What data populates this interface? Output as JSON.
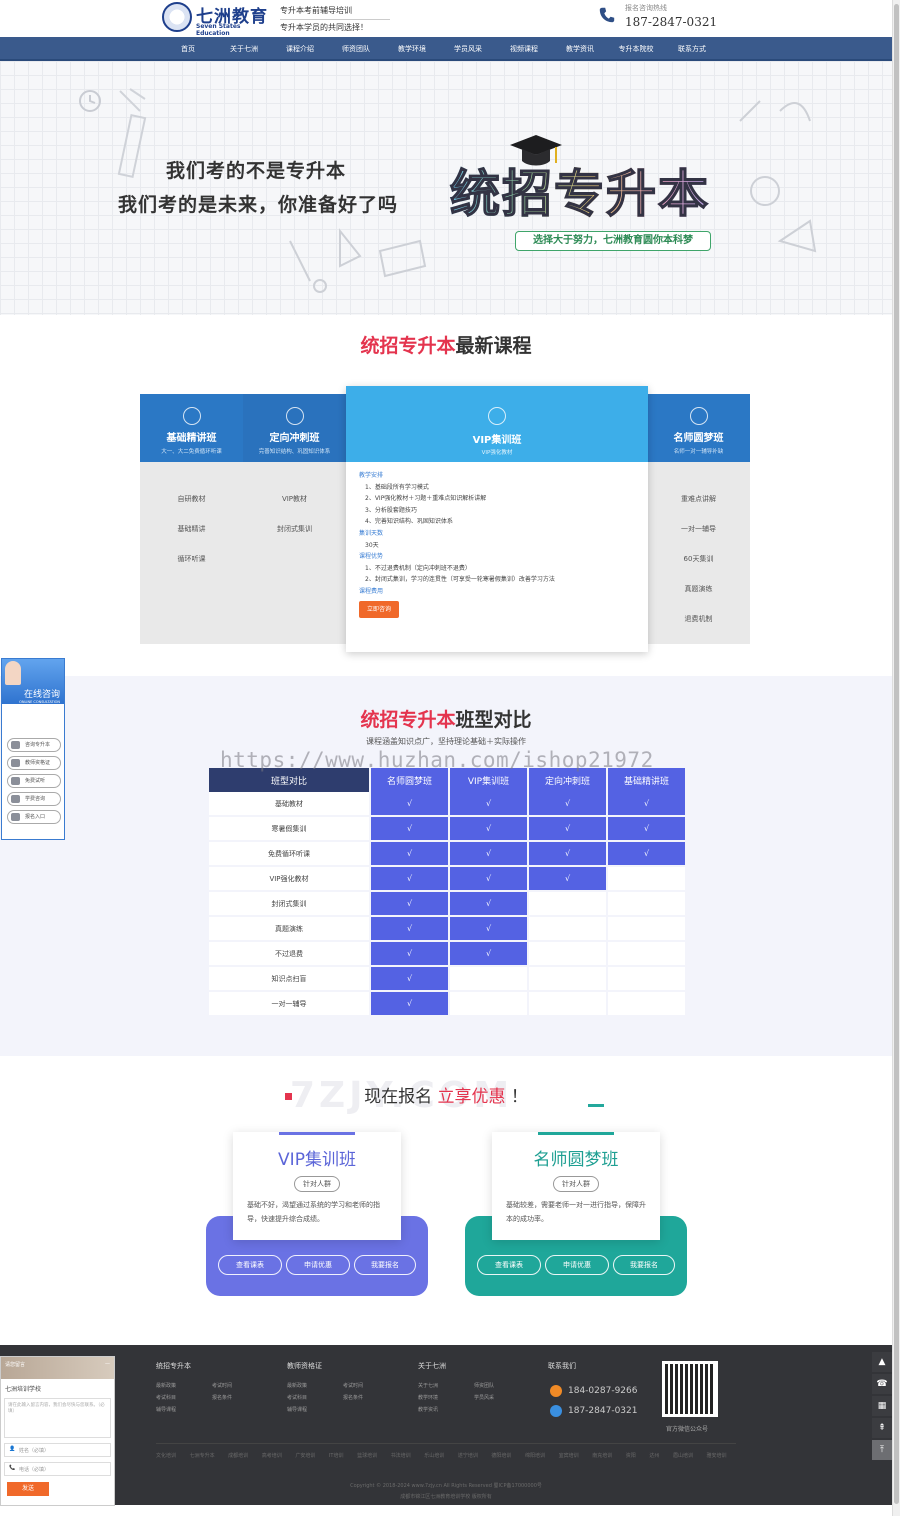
{
  "header": {
    "logo_cn": "七洲教育",
    "logo_en": "Seven States Education",
    "slogan1": "专升本考前辅导培训",
    "slogan2": "专升本学员的共同选择！",
    "hotline_label": "报名咨询热线",
    "hotline": "187-2847-0321"
  },
  "nav": [
    "首页",
    "关于七洲",
    "课程介绍",
    "师资团队",
    "教学环境",
    "学员风采",
    "视频课程",
    "教学资讯",
    "专升本院校",
    "联系方式"
  ],
  "banner": {
    "line1": "我们考的不是专升本",
    "line2": "我们考的是未来，你准备好了吗",
    "big": "统招专升本",
    "pill": "选择大于努力，七洲教育圆你本科梦"
  },
  "courses": {
    "title_hl": "统招专升本",
    "title_rest": "最新课程",
    "tabs": [
      {
        "name": "基础精讲班",
        "sub": "大一、大二免费循环听课",
        "items": [
          "自研教材",
          "基础精讲",
          "循环听课"
        ]
      },
      {
        "name": "定向冲刺班",
        "sub": "完善知识结构、巩固知识体系",
        "items": [
          "VIP教材",
          "封闭式集训"
        ]
      },
      {
        "name": "名师圆梦班",
        "sub": "名师一对一辅导补缺",
        "items": [
          "重难点讲解",
          "一对一辅导",
          "60天集训",
          "真题演练",
          "退费机制"
        ]
      }
    ],
    "vip": {
      "name": "VIP集训班",
      "sub": "VIP强化教材",
      "h1": "教学安排",
      "arr": [
        "1、基础段所有学习模式",
        "2、VIP强化教材＋习题＋重难点知识解析讲解",
        "3、分析股套题技巧",
        "4、完善知识结构、巩固知识体系"
      ],
      "h2": "集训天数",
      "days": "30天",
      "h3": "课程优势",
      "adv": [
        "1、不过退费机制（定向冲刺班不退费）",
        "2、封闭式集训，学习的连贯性（可享受一轮寒暑假集训）改善学习方法"
      ],
      "h4": "课程费用",
      "btn": "立即咨询"
    }
  },
  "side_widget": {
    "title": "在线咨询",
    "sub": "ONLINE CONSULTATION",
    "items": [
      "咨询专升本",
      "教师资格证",
      "免费试听",
      "学费咨询",
      "报名入口"
    ]
  },
  "compare": {
    "title_hl": "统招专升本",
    "title_rest": "班型对比",
    "subtitle": "课程涵盖知识点广，坚持理论基础＋实际操作",
    "watermark": "https://www.huzhan.com/ishop21972",
    "headers": [
      "班型对比",
      "名师圆梦班",
      "VIP集训班",
      "定向冲刺班",
      "基础精讲班"
    ],
    "rows": [
      {
        "label": "基础教材",
        "v": [
          "√",
          "√",
          "√",
          "√"
        ]
      },
      {
        "label": "寒暑假集训",
        "v": [
          "√",
          "√",
          "√",
          "√"
        ]
      },
      {
        "label": "免费循环听课",
        "v": [
          "√",
          "√",
          "√",
          "√"
        ]
      },
      {
        "label": "VIP强化教材",
        "v": [
          "√",
          "√",
          "√",
          ""
        ]
      },
      {
        "label": "封闭式集训",
        "v": [
          "√",
          "√",
          "",
          ""
        ]
      },
      {
        "label": "真题演练",
        "v": [
          "√",
          "√",
          "",
          ""
        ]
      },
      {
        "label": "不过退费",
        "v": [
          "√",
          "√",
          "",
          ""
        ]
      },
      {
        "label": "知识点扫盲",
        "v": [
          "√",
          "",
          "",
          ""
        ]
      },
      {
        "label": "一对一辅导",
        "v": [
          "√",
          "",
          "",
          ""
        ]
      }
    ]
  },
  "register": {
    "ghost": "7ZJY.COM",
    "prefix": "现在报名",
    "hl": "立享优惠",
    "suffix": "！",
    "cards": [
      {
        "name": "VIP集训班",
        "tag": "针对人群",
        "desc": "基础不好，渴望通过系统的学习和老师的指导，快速提升综合成绩。",
        "buttons": [
          "查看课表",
          "申请优惠",
          "我要报名"
        ],
        "color": "#6a72e4",
        "title_color": "#5b65d8"
      },
      {
        "name": "名师圆梦班",
        "tag": "针对人群",
        "desc": "基础较差，需要老师一对一进行指导，保障升本的成功率。",
        "buttons": [
          "查看课表",
          "申请优惠",
          "我要报名"
        ],
        "color": "#1fa79a",
        "title_color": "#1e9f92"
      }
    ]
  },
  "footer": {
    "cols": [
      {
        "title": "统招专升本",
        "links": [
          "最新政策",
          "考试时间",
          "考试科目",
          "报名条件",
          "辅导课程"
        ]
      },
      {
        "title": "教师资格证",
        "links": [
          "最新政策",
          "考试时间",
          "考试科目",
          "报名条件",
          "辅导课程"
        ]
      },
      {
        "title": "关于七洲",
        "links": [
          "关于七洲",
          "师资团队",
          "教学环境",
          "学员风采",
          "教学资讯"
        ]
      }
    ],
    "contact_title": "联系我们",
    "phones": [
      "184-0287-9266",
      "187-2847-0321"
    ],
    "qr_caption": "官方微信公众号",
    "links2": "文化培训 七洲专升本 成都培训 高考培训 广安培训 IT培训 篮球培训 书法培训 乐山培训 遂宁培训 德阳培训 绵阳培训 宜宾培训 南充培训 资阳 达州 眉山培训 雅安培训",
    "copyright": "Copyright © 2018-2024 www.7zjy.cn All Rights Reserved 蜀ICP备17000000号",
    "copyright2": "成都市锦江区七洲教育培训学校 版权所有"
  },
  "message_box": {
    "head": "请您留言",
    "org": "七洲培训学校",
    "area": "请在此输入留言内容，我们会尽快与您联系。（必填）",
    "name": "姓名（必填）",
    "phone": "电话（必填）",
    "send": "发送"
  },
  "rail": [
    "▲",
    "☎",
    "▦",
    "⇞",
    "⤒"
  ]
}
